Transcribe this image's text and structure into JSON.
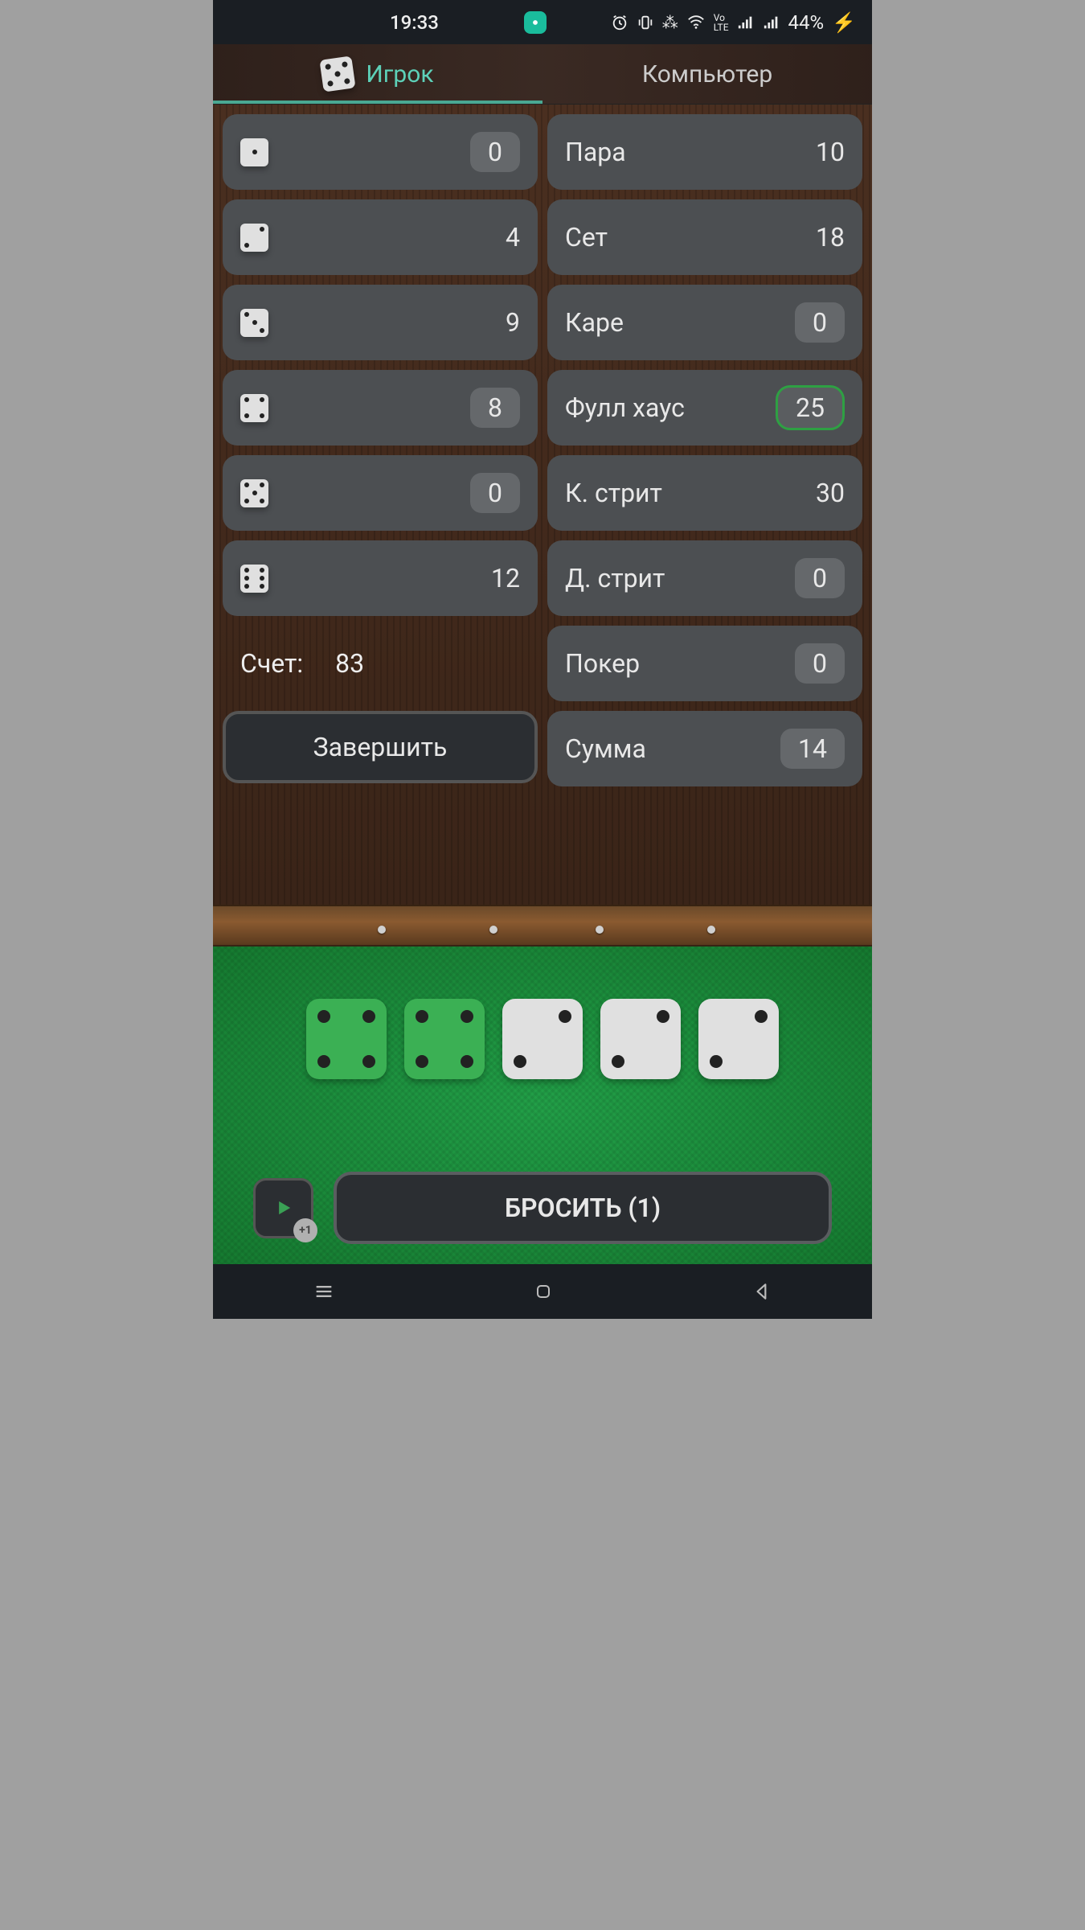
{
  "status": {
    "time": "19:33",
    "battery": "44%"
  },
  "tabs": {
    "player": "Игрок",
    "computer": "Компьютер"
  },
  "left_col": [
    {
      "face": 1,
      "value": "0",
      "pill": true
    },
    {
      "face": 2,
      "value": "4",
      "pill": false
    },
    {
      "face": 3,
      "value": "9",
      "pill": false
    },
    {
      "face": 4,
      "value": "8",
      "pill": true
    },
    {
      "face": 5,
      "value": "0",
      "pill": true
    },
    {
      "face": 6,
      "value": "12",
      "pill": false
    }
  ],
  "score": {
    "label": "Счет:",
    "value": "83"
  },
  "finish_label": "Завершить",
  "right_col": [
    {
      "label": "Пара",
      "value": "10",
      "pill": false
    },
    {
      "label": "Сет",
      "value": "18",
      "pill": false
    },
    {
      "label": "Каре",
      "value": "0",
      "pill": true
    },
    {
      "label": "Фулл хаус",
      "value": "25",
      "pill": true,
      "highlight": true
    },
    {
      "label": "К. стрит",
      "value": "30",
      "pill": false
    },
    {
      "label": "Д. стрит",
      "value": "0",
      "pill": true
    },
    {
      "label": "Покер",
      "value": "0",
      "pill": true
    },
    {
      "label": "Сумма",
      "value": "14",
      "pill": true
    }
  ],
  "dice": [
    {
      "face": 4,
      "held": true
    },
    {
      "face": 4,
      "held": true
    },
    {
      "face": 2,
      "held": false
    },
    {
      "face": 2,
      "held": false
    },
    {
      "face": 2,
      "held": false
    }
  ],
  "ad_plus": "+1",
  "roll_label": "БРОСИТЬ (1)"
}
